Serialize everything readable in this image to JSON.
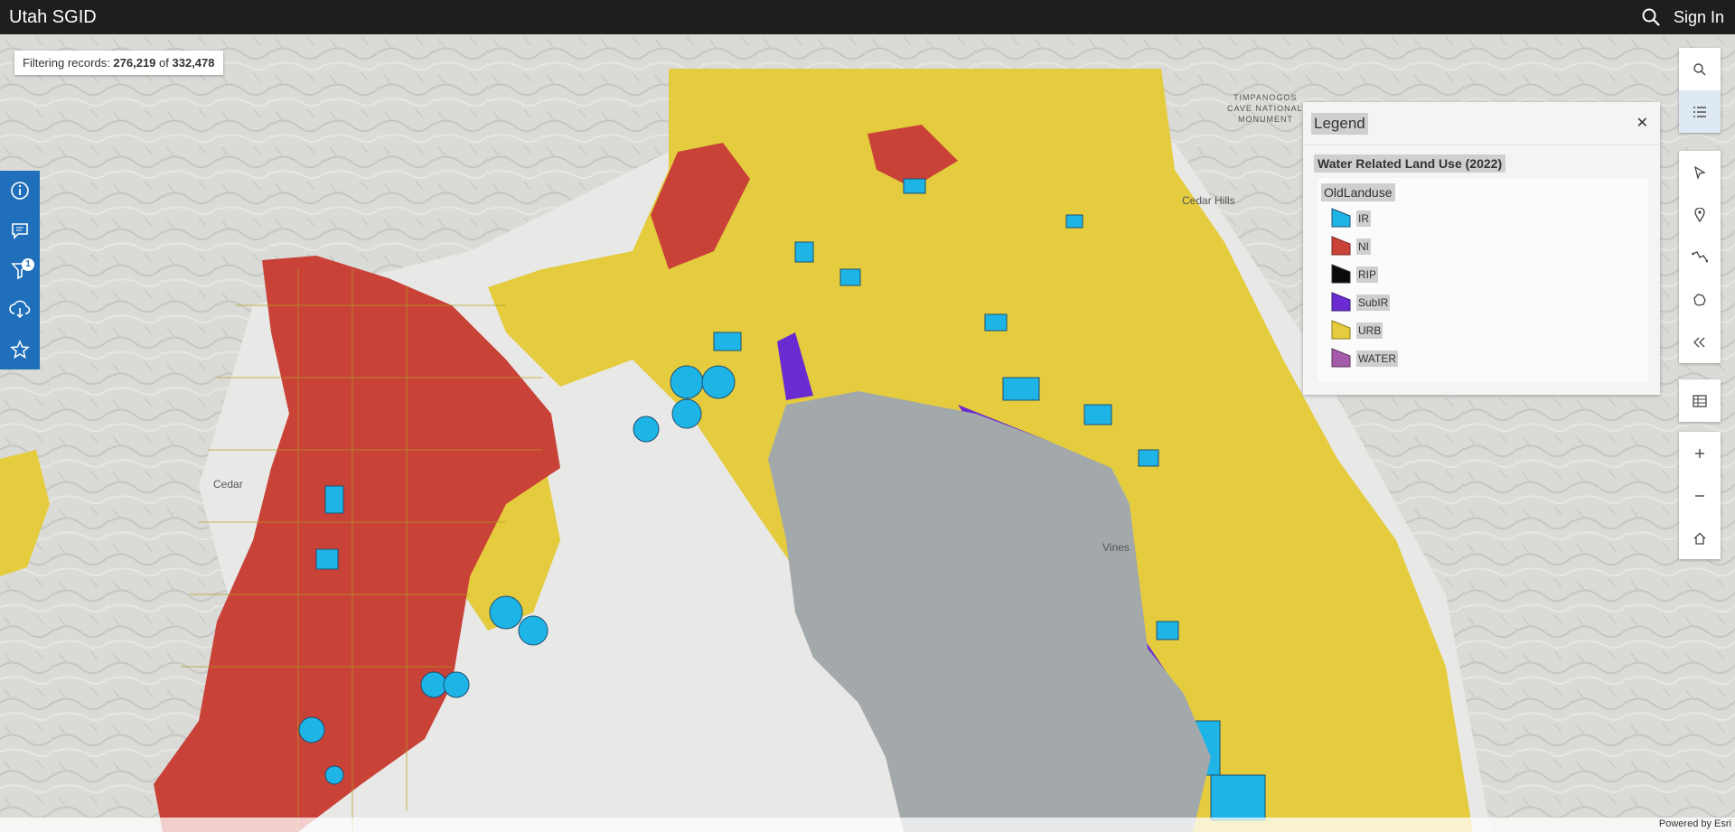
{
  "header": {
    "title": "Utah SGID",
    "sign_in": "Sign In"
  },
  "filter": {
    "prefix": "Filtering records: ",
    "shown": "276,219",
    "of": " of ",
    "total": "332,478"
  },
  "left_tools": [
    {
      "name": "info-icon"
    },
    {
      "name": "comment-icon"
    },
    {
      "name": "filter-icon",
      "badge": "1"
    },
    {
      "name": "download-icon"
    },
    {
      "name": "bookmark-star-icon"
    }
  ],
  "right_tools": {
    "group1": [
      {
        "name": "search-icon"
      },
      {
        "name": "layer-list-icon",
        "active": true
      }
    ],
    "group2": [
      {
        "name": "select-icon"
      },
      {
        "name": "marker-icon"
      },
      {
        "name": "measure-icon"
      },
      {
        "name": "sketch-icon"
      },
      {
        "name": "collapse-icon"
      }
    ],
    "group3": [
      {
        "name": "table-icon"
      }
    ],
    "group4": [
      {
        "name": "zoom-in-icon"
      },
      {
        "name": "zoom-out-icon"
      },
      {
        "name": "home-icon"
      }
    ]
  },
  "legend": {
    "title": "Legend",
    "layer": "Water Related Land Use (2022)",
    "field": "OldLanduse",
    "items": [
      {
        "label": "IR",
        "color": "#1fb4e6"
      },
      {
        "label": "NI",
        "color": "#c94238"
      },
      {
        "label": "RIP",
        "color": "#0b0b0b"
      },
      {
        "label": "SubIR",
        "color": "#6a2cd0"
      },
      {
        "label": "URB",
        "color": "#e4cc3e"
      },
      {
        "label": "WATER",
        "color": "#a35baa"
      }
    ]
  },
  "map_labels": {
    "monument": [
      "TIMPANOGOS",
      "CAVE NATIONAL",
      "MONUMENT"
    ],
    "cedar_hills": "Cedar Hills",
    "cedar": "Cedar",
    "vines": "Vines"
  },
  "footer": {
    "powered": "Powered by Esri"
  }
}
